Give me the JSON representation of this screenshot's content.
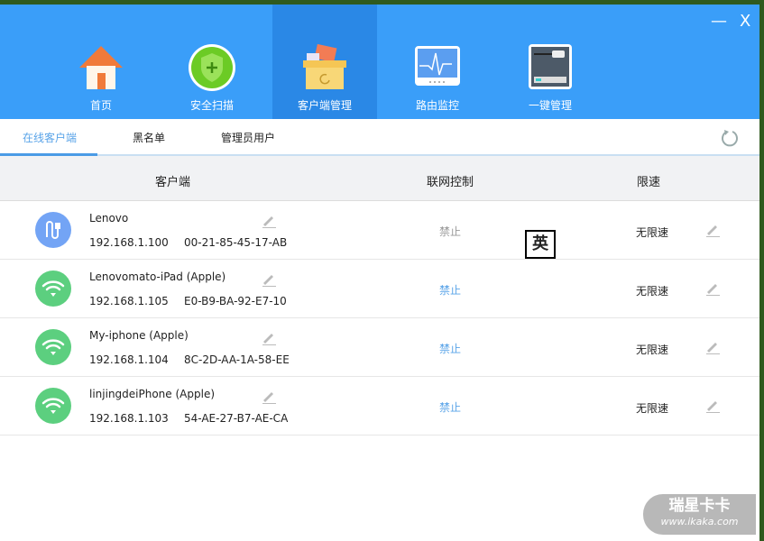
{
  "window": {
    "minimize": "—",
    "close": "X"
  },
  "nav": [
    {
      "label": "首页",
      "icon": "home-icon"
    },
    {
      "label": "安全扫描",
      "icon": "shield-icon"
    },
    {
      "label": "客户端管理",
      "icon": "box-icon",
      "active": true
    },
    {
      "label": "路由监控",
      "icon": "monitor-icon"
    },
    {
      "label": "一键管理",
      "icon": "router-icon"
    }
  ],
  "tabs": [
    {
      "label": "在线客户端",
      "active": true
    },
    {
      "label": "黑名单"
    },
    {
      "label": "管理员用户"
    }
  ],
  "columns": {
    "client": "客户端",
    "control": "联网控制",
    "speed": "限速"
  },
  "clients": [
    {
      "name": "Lenovo",
      "ip": "192.168.1.100",
      "mac": "00-21-85-45-17-AB",
      "control": "禁止",
      "speed": "无限速",
      "type": "wired",
      "disabled": true
    },
    {
      "name": "Lenovomato-iPad  (Apple)",
      "ip": "192.168.1.105",
      "mac": "E0-B9-BA-92-E7-10",
      "control": "禁止",
      "speed": "无限速",
      "type": "wifi"
    },
    {
      "name": "My-iphone  (Apple)",
      "ip": "192.168.1.104",
      "mac": "8C-2D-AA-1A-58-EE",
      "control": "禁止",
      "speed": "无限速",
      "type": "wifi"
    },
    {
      "name": "linjingdeiPhone   (Apple)",
      "ip": "192.168.1.103",
      "mac": "54-AE-27-B7-AE-CA",
      "control": "禁止",
      "speed": "无限速",
      "type": "wifi"
    }
  ],
  "ime": "英",
  "watermark": {
    "title": "瑞星卡卡",
    "url": "www.ikaka.com"
  },
  "colors": {
    "header": "#3a9ef9",
    "accent": "#5aa4e8",
    "wifi": "#5ccf7f",
    "wired": "#73a4f5"
  }
}
